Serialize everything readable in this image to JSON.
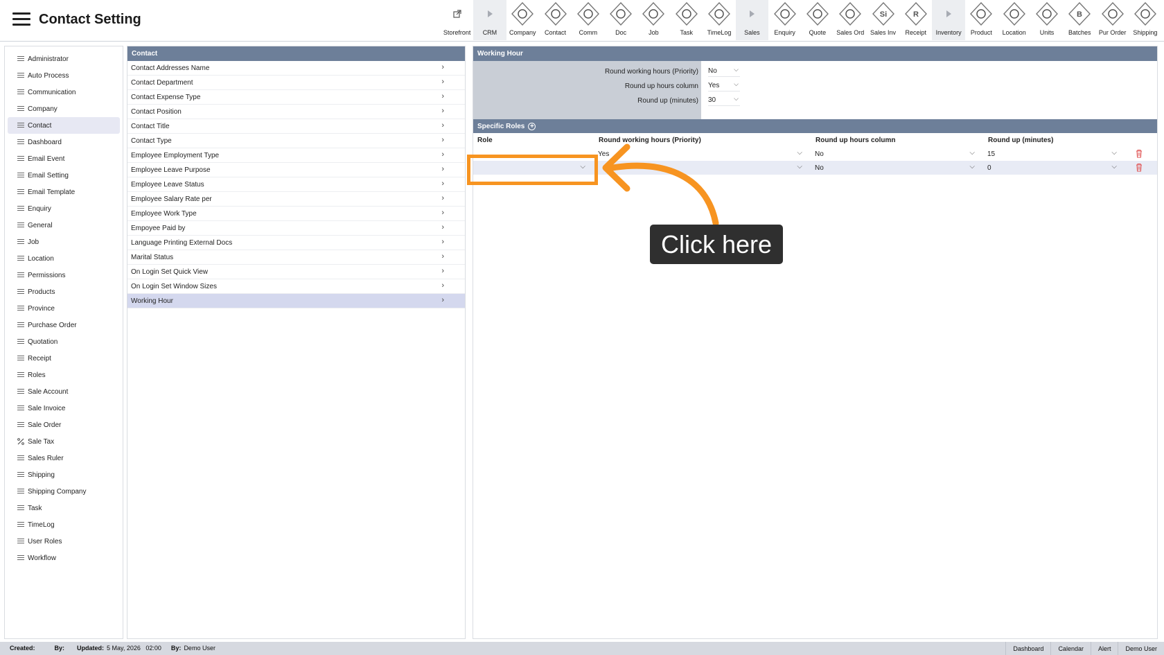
{
  "header": {
    "title": "Contact Setting"
  },
  "toolbar": [
    {
      "label": "Storefront",
      "icon": "external-link-icon",
      "sep": false
    },
    {
      "label": "CRM",
      "icon": "caret-right-icon",
      "sep": true
    },
    {
      "label": "Company",
      "icon": "company-icon",
      "sep": false
    },
    {
      "label": "Contact",
      "icon": "contact-icon",
      "sep": false
    },
    {
      "label": "Comm",
      "icon": "comm-icon",
      "sep": false
    },
    {
      "label": "Doc",
      "icon": "doc-icon",
      "sep": false
    },
    {
      "label": "Job",
      "icon": "job-icon",
      "sep": false
    },
    {
      "label": "Task",
      "icon": "task-icon",
      "sep": false
    },
    {
      "label": "TimeLog",
      "icon": "clock-icon",
      "sep": false
    },
    {
      "label": "Sales",
      "icon": "caret-right-icon",
      "sep": true
    },
    {
      "label": "Enquiry",
      "icon": "enquiry-icon",
      "sep": false
    },
    {
      "label": "Quote",
      "icon": "quote-icon",
      "sep": false
    },
    {
      "label": "Sales Ord",
      "icon": "sales-order-icon",
      "sep": false
    },
    {
      "label": "Sales Inv",
      "icon": "sales-invoice-icon",
      "glyph": "Si",
      "sep": false
    },
    {
      "label": "Receipt",
      "icon": "receipt-icon",
      "glyph": "R",
      "sep": false
    },
    {
      "label": "Inventory",
      "icon": "caret-right-icon",
      "sep": true
    },
    {
      "label": "Product",
      "icon": "product-icon",
      "sep": false
    },
    {
      "label": "Location",
      "icon": "location-icon",
      "sep": false
    },
    {
      "label": "Units",
      "icon": "units-icon",
      "sep": false
    },
    {
      "label": "Batches",
      "icon": "batches-icon",
      "glyph": "B",
      "sep": false
    },
    {
      "label": "Pur Order",
      "icon": "cart-icon",
      "sep": false
    },
    {
      "label": "Shipping",
      "icon": "truck-icon",
      "sep": false
    }
  ],
  "sidebar": {
    "items": [
      {
        "label": "Administrator"
      },
      {
        "label": "Auto Process"
      },
      {
        "label": "Communication"
      },
      {
        "label": "Company"
      },
      {
        "label": "Contact",
        "active": true
      },
      {
        "label": "Dashboard"
      },
      {
        "label": "Email Event"
      },
      {
        "label": "Email Setting"
      },
      {
        "label": "Email Template"
      },
      {
        "label": "Enquiry"
      },
      {
        "label": "General"
      },
      {
        "label": "Job"
      },
      {
        "label": "Location"
      },
      {
        "label": "Permissions"
      },
      {
        "label": "Products"
      },
      {
        "label": "Province"
      },
      {
        "label": "Purchase Order"
      },
      {
        "label": "Quotation"
      },
      {
        "label": "Receipt"
      },
      {
        "label": "Roles"
      },
      {
        "label": "Sale Account"
      },
      {
        "label": "Sale Invoice"
      },
      {
        "label": "Sale Order"
      },
      {
        "label": "Sale Tax",
        "icon": "percent-icon"
      },
      {
        "label": "Sales Ruler"
      },
      {
        "label": "Shipping"
      },
      {
        "label": "Shipping Company"
      },
      {
        "label": "Task"
      },
      {
        "label": "TimeLog"
      },
      {
        "label": "User Roles"
      },
      {
        "label": "Workflow"
      }
    ]
  },
  "middle": {
    "header": "Contact",
    "items": [
      {
        "label": "Contact Addresses Name"
      },
      {
        "label": "Contact Department"
      },
      {
        "label": "Contact Expense Type"
      },
      {
        "label": "Contact Position"
      },
      {
        "label": "Contact Title"
      },
      {
        "label": "Contact Type"
      },
      {
        "label": "Employee Employment Type"
      },
      {
        "label": "Employee Leave Purpose"
      },
      {
        "label": "Employee Leave Status"
      },
      {
        "label": "Employee Salary Rate per"
      },
      {
        "label": "Employee Work Type"
      },
      {
        "label": "Empoyee Paid by"
      },
      {
        "label": "Language Printing External Docs"
      },
      {
        "label": "Marital Status"
      },
      {
        "label": "On Login Set Quick View"
      },
      {
        "label": "On Login Set Window Sizes"
      },
      {
        "label": "Working Hour",
        "active": true
      }
    ]
  },
  "working_hour": {
    "header": "Working Hour",
    "rows": [
      {
        "label": "Round working hours (Priority)",
        "value": "No"
      },
      {
        "label": "Round up hours column",
        "value": "Yes"
      },
      {
        "label": "Round up (minutes)",
        "value": "30"
      }
    ]
  },
  "specific_roles": {
    "header": "Specific Roles",
    "columns": [
      "Role",
      "Round working hours (Priority)",
      "Round up hours column",
      "Round up (minutes)"
    ],
    "rows": [
      {
        "role": "",
        "priority": "Yes",
        "column": "No",
        "minutes": "15"
      },
      {
        "role": "",
        "priority": "",
        "column": "No",
        "minutes": "0"
      }
    ]
  },
  "annotation": {
    "text": "Click here",
    "color": "#f79421"
  },
  "footer": {
    "created_label": "Created:",
    "by_label": "By:",
    "updated_label": "Updated:",
    "updated_value": "5 May, 2026   02:00",
    "by2_label": "By:",
    "by2_value": "Demo User",
    "buttons": [
      "Dashboard",
      "Calendar",
      "Alert",
      "Demo User"
    ]
  }
}
